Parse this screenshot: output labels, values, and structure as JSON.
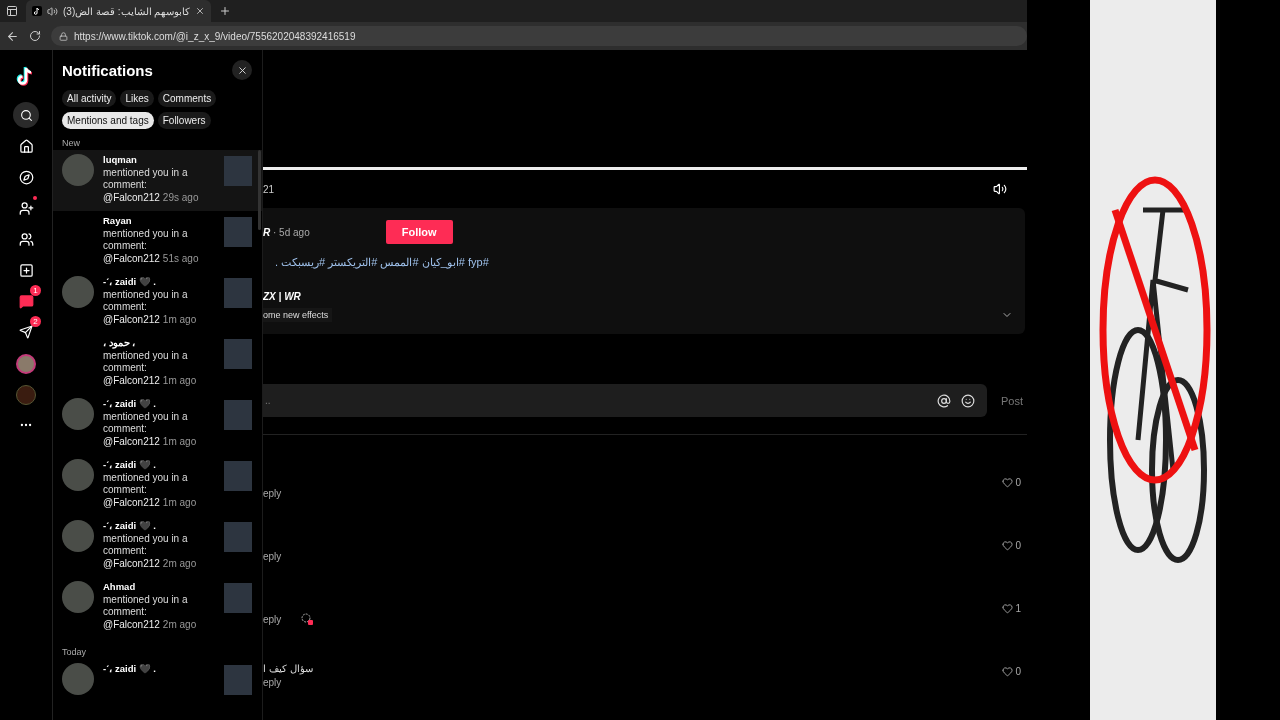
{
  "browser": {
    "tab_title": "(3)كابوسهم الشايب: قصة الض",
    "url": "https://www.tiktok.com/@i_z_x_9/video/7556202048392416519"
  },
  "sidebar": {
    "message_badge": "1",
    "inbox_badge": "2"
  },
  "notifications": {
    "title": "Notifications",
    "filters": [
      {
        "label": "All activity",
        "selected": false
      },
      {
        "label": "Likes",
        "selected": false
      },
      {
        "label": "Comments",
        "selected": false
      },
      {
        "label": "Mentions and tags",
        "selected": true
      },
      {
        "label": "Followers",
        "selected": false
      }
    ],
    "sections": [
      {
        "label": "New",
        "items": [
          {
            "name": "luqman",
            "message": "mentioned you in a comment:",
            "mention": "@Falcon212",
            "time": "29s ago",
            "avatar": true,
            "highlighted": true
          },
          {
            "name": "Rayan",
            "message": "mentioned you in a comment:",
            "mention": "@Falcon212",
            "time": "51s ago",
            "avatar": false,
            "highlighted": false
          },
          {
            "name": "-ˊ، zaidi 🖤 .",
            "message": "mentioned you in a comment:",
            "mention": "@Falcon212",
            "time": "1m ago",
            "avatar": true,
            "highlighted": false
          },
          {
            "name": "، حمود ،",
            "message": "mentioned you in a comment:",
            "mention": "@Falcon212",
            "time": "1m ago",
            "avatar": false,
            "highlighted": false
          },
          {
            "name": "-ˊ، zaidi 🖤 .",
            "message": "mentioned you in a comment:",
            "mention": "@Falcon212",
            "time": "1m ago",
            "avatar": true,
            "highlighted": false
          },
          {
            "name": "-ˊ، zaidi 🖤 .",
            "message": "mentioned you in a comment:",
            "mention": "@Falcon212",
            "time": "1m ago",
            "avatar": true,
            "highlighted": false
          },
          {
            "name": "-ˊ، zaidi 🖤 .",
            "message": "mentioned you in a comment:",
            "mention": "@Falcon212",
            "time": "2m ago",
            "avatar": true,
            "highlighted": false
          },
          {
            "name": "Ahmad",
            "message": "mentioned you in a comment:",
            "mention": "@Falcon212",
            "time": "2m ago",
            "avatar": true,
            "highlighted": false
          }
        ]
      },
      {
        "label": "Today",
        "items": [
          {
            "name": "-ˊ، zaidi 🖤 .",
            "avatar": true,
            "highlighted": false
          }
        ]
      }
    ]
  },
  "video": {
    "time_fragment": "21",
    "progress": {
      "level": 1
    }
  },
  "post": {
    "author_fragment": "R",
    "age": "· 5d ago",
    "follow": "Follow",
    "caption": "#fyp #ابو_كيان #الممس #التريكستر #ريسبكت .",
    "music_fragment": "ZX | WR",
    "effect_fragment": "ome new effects"
  },
  "comment_box": {
    "placeholder": "..",
    "post": "Post"
  },
  "comments": [
    {
      "reply": "eply",
      "likes": "0",
      "creator_liked": false
    },
    {
      "reply": "eply",
      "likes": "0",
      "creator_liked": false
    },
    {
      "reply": "eply",
      "likes": "1",
      "creator_liked": true
    },
    {
      "text": "سؤال كيف ا",
      "reply": "eply",
      "likes": "0",
      "creator_liked": false
    }
  ]
}
